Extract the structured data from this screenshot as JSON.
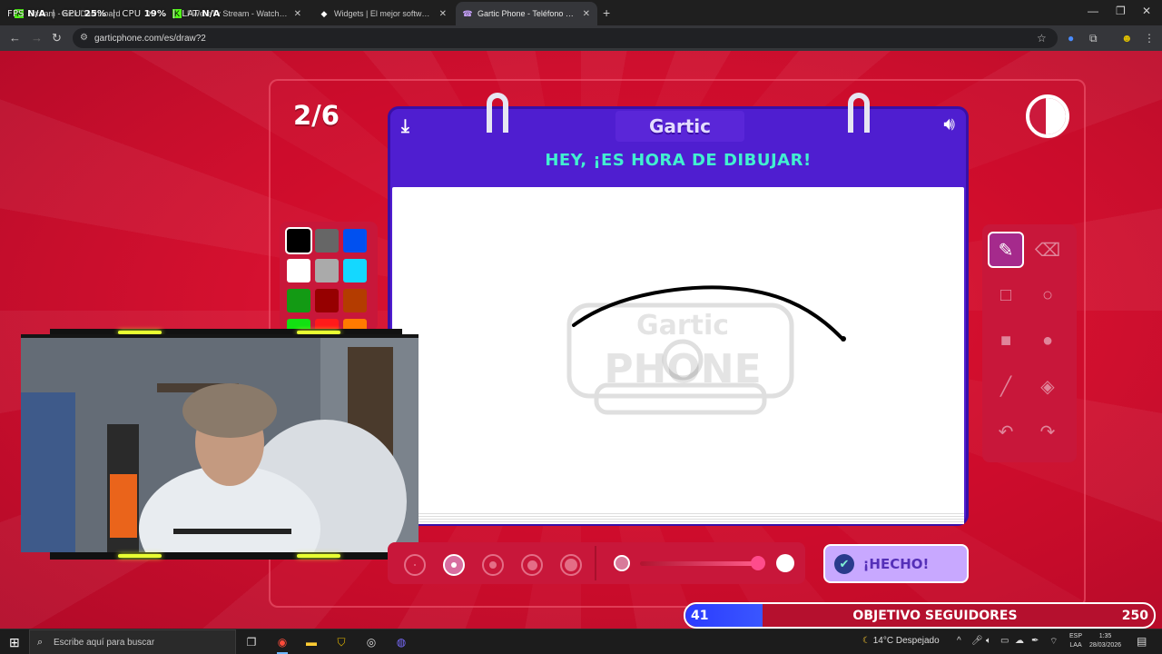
{
  "overlay": {
    "fps_label": "FPS",
    "fps_value": "N/A",
    "gpu_label": "GPU",
    "gpu_value": "25%",
    "cpu_label": "CPU",
    "cpu_value": "19%",
    "lat_label": "LAT",
    "lat_value": "N/A"
  },
  "browser": {
    "tabs": [
      {
        "title": "Stream - Kick Dashboard",
        "active": false
      },
      {
        "title": "FWereTv Stream - Watch Live on Kick",
        "active": false
      },
      {
        "title": "Widgets | El mejor software para streamers",
        "active": false
      },
      {
        "title": "Gartic Phone - Teléfono Descompuesto",
        "active": true
      }
    ],
    "url": "garticphone.com/es/draw?2"
  },
  "game": {
    "round": "2/6",
    "logo": "Gartic",
    "instruction": "HEY, ¡ES HORA DE DIBUJAR!",
    "done_label": "¡HECHO!",
    "timer_remaining": 0.55,
    "palette": [
      {
        "name": "black",
        "color": "#000000",
        "selected": true
      },
      {
        "name": "gray",
        "color": "#666666",
        "selected": false
      },
      {
        "name": "blue",
        "color": "#0050f0",
        "selected": false
      },
      {
        "name": "white",
        "color": "#ffffff",
        "selected": false
      },
      {
        "name": "light-gray",
        "color": "#aaaaaa",
        "selected": false
      },
      {
        "name": "cyan",
        "color": "#14d8ff",
        "selected": false
      },
      {
        "name": "green",
        "color": "#139a14",
        "selected": false
      },
      {
        "name": "dark-red",
        "color": "#960000",
        "selected": false
      },
      {
        "name": "brown",
        "color": "#b43c00",
        "selected": false
      },
      {
        "name": "lime",
        "color": "#12e012",
        "selected": false
      },
      {
        "name": "red",
        "color": "#ff1a1a",
        "selected": false
      },
      {
        "name": "orange",
        "color": "#ff7a00",
        "selected": false
      }
    ],
    "tools": [
      "pencil-icon",
      "eraser-icon",
      "rect-outline-icon",
      "circle-outline-icon",
      "rect-filled-icon",
      "circle-filled-icon",
      "line-icon",
      "fill-bucket-icon",
      "undo-icon",
      "redo-icon"
    ],
    "brush_sizes_selected_index": 1,
    "opacity": 1.0
  },
  "goal": {
    "current": "41",
    "label": "OBJETIVO SEGUIDORES",
    "target": "250",
    "progress": 0.164
  },
  "taskbar": {
    "search_placeholder": "Escribe aquí para buscar",
    "weather": "14°C  Despejado",
    "lang_1": "ESP",
    "lang_2": "LAA",
    "time": "1:35",
    "date": "28/03/2026"
  }
}
